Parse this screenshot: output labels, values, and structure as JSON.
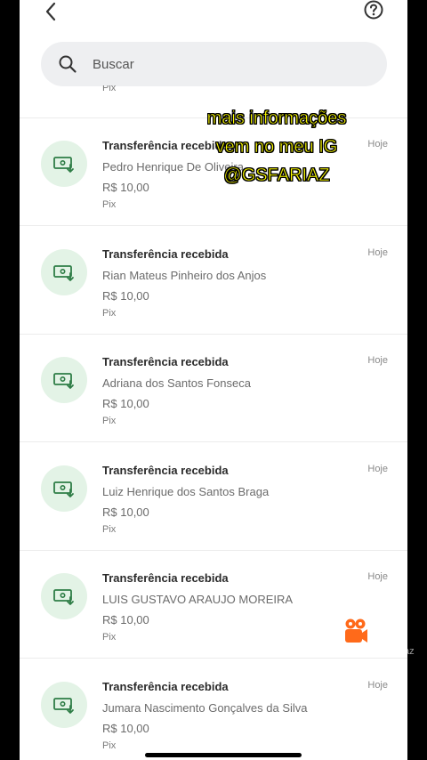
{
  "header": {
    "search_placeholder": "Buscar"
  },
  "partial_item": {
    "method": "Pix"
  },
  "transactions": [
    {
      "title": "Transferência recebida",
      "name": "Pedro Henrique De Oliveira",
      "amount": "R$ 10,00",
      "method": "Pix",
      "date": "Hoje"
    },
    {
      "title": "Transferência recebida",
      "name": "Rian Mateus Pinheiro dos Anjos",
      "amount": "R$ 10,00",
      "method": "Pix",
      "date": "Hoje"
    },
    {
      "title": "Transferência recebida",
      "name": "Adriana dos Santos Fonseca",
      "amount": "R$ 10,00",
      "method": "Pix",
      "date": "Hoje"
    },
    {
      "title": "Transferência recebida",
      "name": "Luiz Henrique dos Santos Braga",
      "amount": "R$ 10,00",
      "method": "Pix",
      "date": "Hoje"
    },
    {
      "title": "Transferência recebida",
      "name": "LUIS GUSTAVO ARAUJO MOREIRA",
      "amount": "R$ 10,00",
      "method": "Pix",
      "date": "Hoje"
    },
    {
      "title": "Transferência recebida",
      "name": "Jumara Nascimento Gonçalves da Silva",
      "amount": "R$ 10,00",
      "method": "Pix",
      "date": "Hoje"
    }
  ],
  "overlay": {
    "line1": "mais informações",
    "line2": "vem no meu IG",
    "line3": "@GSFARIAZ"
  },
  "watermark": {
    "brand": "Kwai",
    "handle": "az"
  },
  "colors": {
    "badge_bg": "#e3f3e6",
    "icon_green": "#2e7d46",
    "overlay_text": "#ffff00"
  },
  "icons": {
    "back": "chevron-left-icon",
    "help": "question-circle-icon",
    "search": "search-icon",
    "transaction": "money-receive-icon"
  }
}
